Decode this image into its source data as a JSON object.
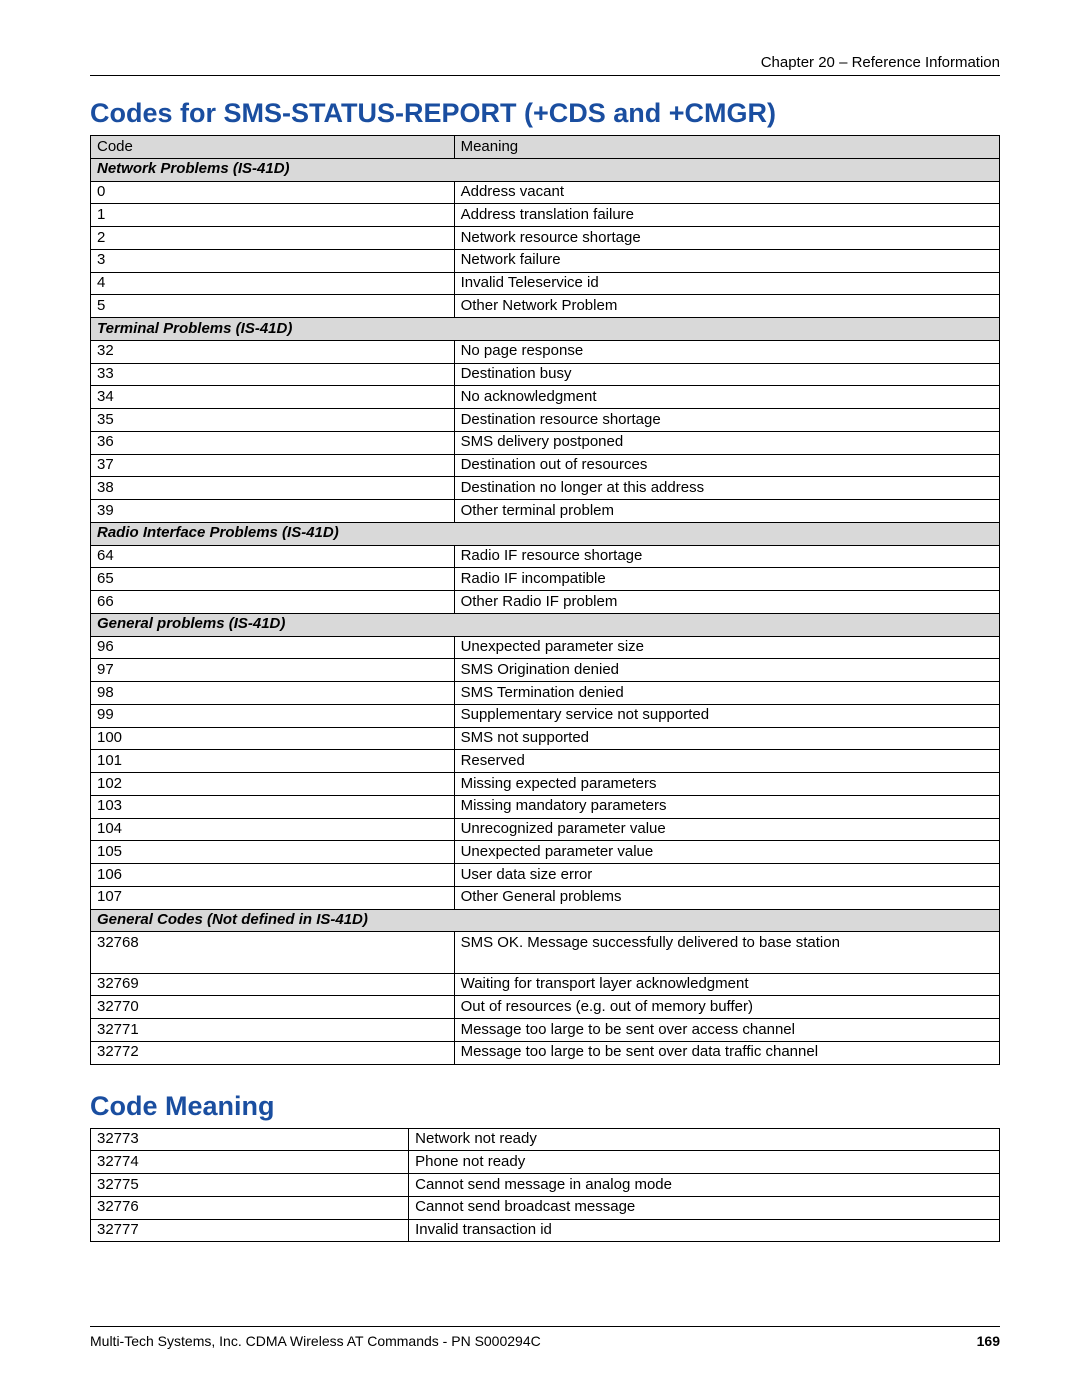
{
  "chapter_header": "Chapter 20 – Reference Information",
  "title1": "Codes for SMS-STATUS-REPORT (+CDS and +CMGR)",
  "title2": "Code Meaning",
  "table1": {
    "header": {
      "code": "Code",
      "meaning": "Meaning"
    },
    "sections": [
      {
        "label": "Network Problems (IS-41D)",
        "rows": [
          {
            "code": "0",
            "meaning": "Address vacant"
          },
          {
            "code": "1",
            "meaning": "Address translation failure"
          },
          {
            "code": "2",
            "meaning": "Network resource shortage"
          },
          {
            "code": "3",
            "meaning": "Network failure"
          },
          {
            "code": "4",
            "meaning": "Invalid Teleservice id"
          },
          {
            "code": "5",
            "meaning": "Other Network Problem"
          }
        ]
      },
      {
        "label": "Terminal Problems (IS-41D)",
        "rows": [
          {
            "code": "32",
            "meaning": "No page response"
          },
          {
            "code": "33",
            "meaning": "Destination busy"
          },
          {
            "code": "34",
            "meaning": "No acknowledgment"
          },
          {
            "code": "35",
            "meaning": "Destination resource shortage"
          },
          {
            "code": "36",
            "meaning": "SMS delivery postponed"
          },
          {
            "code": "37",
            "meaning": "Destination out of resources"
          },
          {
            "code": "38",
            "meaning": "Destination no longer at this address"
          },
          {
            "code": "39",
            "meaning": "Other terminal problem"
          }
        ]
      },
      {
        "label": "Radio Interface Problems (IS-41D)",
        "rows": [
          {
            "code": "64",
            "meaning": "Radio IF resource shortage"
          },
          {
            "code": "65",
            "meaning": "Radio IF incompatible"
          },
          {
            "code": "66",
            "meaning": "Other Radio IF problem"
          }
        ]
      },
      {
        "label": "General problems (IS-41D)",
        "rows": [
          {
            "code": "96",
            "meaning": "Unexpected parameter size"
          },
          {
            "code": "97",
            "meaning": "SMS Origination denied"
          },
          {
            "code": "98",
            "meaning": "SMS Termination denied"
          },
          {
            "code": "99",
            "meaning": "Supplementary service not supported"
          },
          {
            "code": "100",
            "meaning": "SMS not supported"
          },
          {
            "code": "101",
            "meaning": "Reserved"
          },
          {
            "code": "102",
            "meaning": "Missing expected parameters"
          },
          {
            "code": "103",
            "meaning": "Missing mandatory parameters"
          },
          {
            "code": "104",
            "meaning": "Unrecognized parameter value"
          },
          {
            "code": "105",
            "meaning": "Unexpected parameter value"
          },
          {
            "code": "106",
            "meaning": "User data size error"
          },
          {
            "code": "107",
            "meaning": "Other General problems"
          }
        ]
      },
      {
        "label": "General Codes (Not defined in IS-41D)",
        "rows": [
          {
            "code": "32768",
            "meaning": "SMS OK. Message successfully delivered to base station",
            "tall": true
          },
          {
            "code": "32769",
            "meaning": "Waiting for transport layer acknowledgment"
          },
          {
            "code": "32770",
            "meaning": "Out of resources (e.g. out of memory buffer)"
          },
          {
            "code": "32771",
            "meaning": "Message too large to be sent over access channel"
          },
          {
            "code": "32772",
            "meaning": "Message too large to be sent over data traffic channel"
          }
        ]
      }
    ]
  },
  "table2": {
    "rows": [
      {
        "code": "32773",
        "meaning": "Network not ready"
      },
      {
        "code": "32774",
        "meaning": "Phone not ready"
      },
      {
        "code": "32775",
        "meaning": "Cannot send message in analog mode"
      },
      {
        "code": "32776",
        "meaning": "Cannot send broadcast message"
      },
      {
        "code": "32777",
        "meaning": "Invalid transaction id"
      }
    ]
  },
  "footer": {
    "text": "Multi-Tech Systems, Inc. CDMA Wireless AT Commands - PN S000294C",
    "page": "169"
  }
}
